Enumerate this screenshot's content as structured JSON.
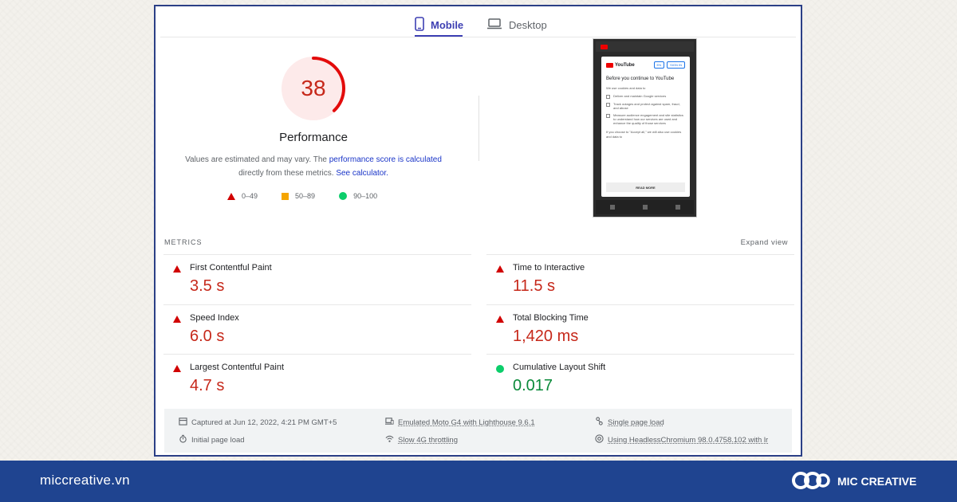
{
  "tabs": [
    {
      "label": "Mobile",
      "active": true
    },
    {
      "label": "Desktop",
      "active": false
    }
  ],
  "performance": {
    "score": "38",
    "score_value": 38,
    "title": "Performance",
    "desc_1": "Values are estimated and may vary. The ",
    "desc_link_1": "performance score is calculated",
    "desc_2": "directly from these metrics. ",
    "desc_link_2": "See calculator."
  },
  "legend": [
    {
      "label": "0–49",
      "icon": "red-triangle-icon"
    },
    {
      "label": "50–89",
      "icon": "orange-square-icon"
    },
    {
      "label": "90–100",
      "icon": "green-circle-icon"
    }
  ],
  "screenshot": {
    "brand": "YouTube",
    "btn_en": "EN",
    "btn_sign_in": "SIGN IN",
    "heading": "Before you continue to YouTube",
    "intro": "We use cookies and data to",
    "items": [
      "Deliver and maintain Google services",
      "Track outages and protect against spam, fraud, and abuse",
      "Measure audience engagement and site statistics to understand how our services are used and enhance the quality of those services"
    ],
    "outro": "If you choose to \"Accept all,\" we will also use cookies and data to",
    "read_more": "READ MORE"
  },
  "metrics": {
    "label": "METRICS",
    "expand": "Expand view",
    "items": [
      {
        "name": "First Contentful Paint",
        "value": "3.5 s",
        "status": "poor"
      },
      {
        "name": "Time to Interactive",
        "value": "11.5 s",
        "status": "poor"
      },
      {
        "name": "Speed Index",
        "value": "6.0 s",
        "status": "poor"
      },
      {
        "name": "Total Blocking Time",
        "value": "1,420 ms",
        "status": "poor"
      },
      {
        "name": "Largest Contentful Paint",
        "value": "4.7 s",
        "status": "poor"
      },
      {
        "name": "Cumulative Layout Shift",
        "value": "0.017",
        "status": "good"
      }
    ]
  },
  "footer": {
    "captured": "Captured at Jun 12, 2022, 4:21 PM GMT+5",
    "device": "Emulated Moto G4 with Lighthouse 9.6.1",
    "load_type": "Single page load",
    "initial": "Initial page load",
    "throttling": "Slow 4G throttling",
    "browser": "Using HeadlessChromium 98.0.4758.102 with lr"
  },
  "bottom_bar": {
    "url": "miccreative.vn",
    "brand": "MIC CREATIVE"
  },
  "colors": {
    "poor": "#c6281a",
    "average": "#f5a500",
    "good": "#0cce6b",
    "accent": "#3d3fb3",
    "bar": "#1f4490"
  }
}
